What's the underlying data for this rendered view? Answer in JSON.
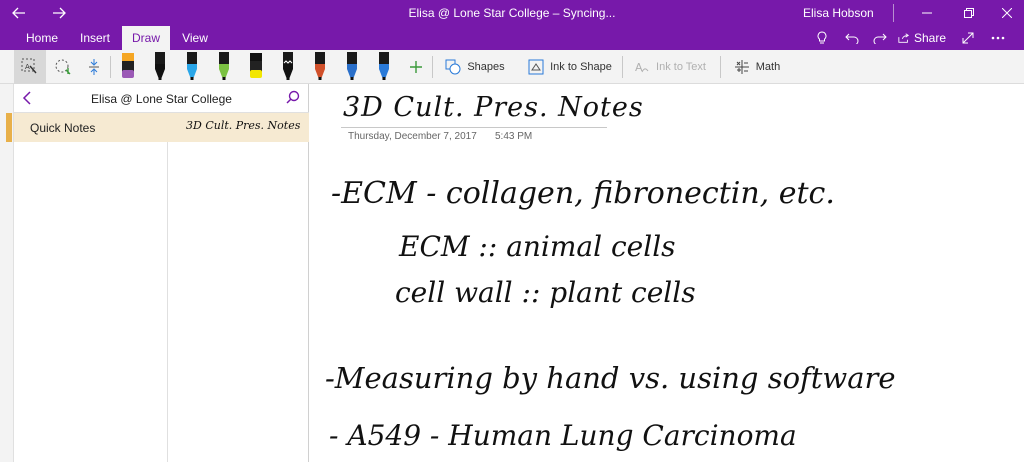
{
  "window": {
    "title": "Elisa @ Lone Star College – Syncing...",
    "user": "Elisa Hobson",
    "back_icon": "back-arrow-icon",
    "forward_icon": "forward-arrow-icon"
  },
  "tabs": [
    {
      "label": "Home"
    },
    {
      "label": "Insert"
    },
    {
      "label": "Draw",
      "active": true
    },
    {
      "label": "View"
    }
  ],
  "ribbon_right": {
    "share_label": "Share"
  },
  "toolbar": {
    "pens": [
      {
        "color": "#9b59b6",
        "cap": "#f5a623",
        "kind": "highlighter"
      },
      {
        "color": "#111111",
        "cap": "#111111",
        "kind": "pen"
      },
      {
        "color": "#2aa6e8",
        "cap": "#111111",
        "kind": "pen"
      },
      {
        "color": "#7bc142",
        "cap": "#111111",
        "kind": "pen"
      },
      {
        "color": "#f2e600",
        "cap": "#111111",
        "kind": "highlighter"
      },
      {
        "color": "#111111",
        "cap": "#111111",
        "kind": "pen-galaxy"
      },
      {
        "color": "#d0502a",
        "cap": "#111111",
        "kind": "pen"
      },
      {
        "color": "#2a6fc9",
        "cap": "#111111",
        "kind": "pen"
      },
      {
        "color": "#2a7ad8",
        "cap": "#111111",
        "kind": "pen"
      }
    ],
    "shapes_label": "Shapes",
    "ink_to_shape_label": "Ink to Shape",
    "ink_to_text_label": "Ink to Text",
    "math_label": "Math",
    "accent": "#7719aa"
  },
  "nav": {
    "notebook_title": "Elisa @ Lone Star College",
    "sections": [
      {
        "label": "Quick Notes",
        "color": "#e8b04a"
      }
    ],
    "pages": [
      {
        "title": "3D Cult. Pres. Notes"
      }
    ]
  },
  "page": {
    "title": "3D Cult. Pres. Notes",
    "date": "Thursday, December 7, 2017",
    "time": "5:43 PM",
    "ink_lines": [
      "-ECM - collagen, fibronectin, etc.",
      "ECM :: animal cells",
      "cell wall :: plant cells",
      "-Measuring by hand vs. using software",
      "- A549 - Human Lung Carcinoma"
    ]
  }
}
